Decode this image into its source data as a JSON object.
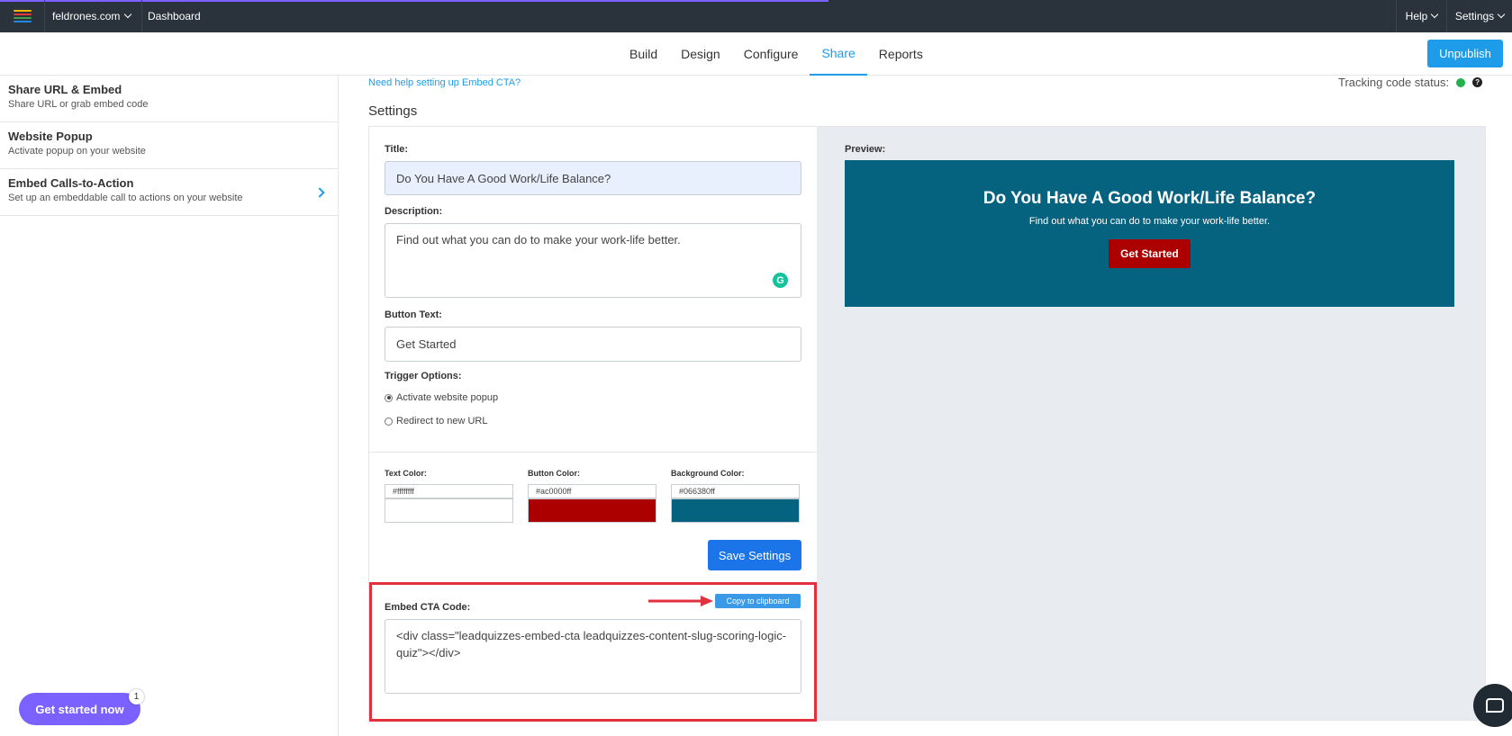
{
  "topbar": {
    "site": "feldrones.com",
    "dashboard": "Dashboard",
    "help": "Help",
    "settings": "Settings"
  },
  "tabs": [
    {
      "label": "Build"
    },
    {
      "label": "Design"
    },
    {
      "label": "Configure"
    },
    {
      "label": "Share",
      "active": true
    },
    {
      "label": "Reports"
    }
  ],
  "unpublish_label": "Unpublish",
  "sidebar": {
    "items": [
      {
        "title": "Share URL & Embed",
        "subtitle": "Share URL or grab embed code"
      },
      {
        "title": "Website Popup",
        "subtitle": "Activate popup on your website"
      },
      {
        "title": "Embed Calls-to-Action",
        "subtitle": "Set up an embeddable call to actions on your website"
      }
    ],
    "get_started": "Get started now",
    "badge_count": "1"
  },
  "main": {
    "help_link": "Need help setting up Embed CTA?",
    "tracking_label": "Tracking code status:",
    "settings_title": "Settings",
    "form": {
      "title_label": "Title:",
      "title_value": "Do You Have A Good Work/Life Balance?",
      "description_label": "Description:",
      "description_value": "Find out what you can do to make your work-life better.",
      "button_text_label": "Button Text:",
      "button_text_value": "Get Started",
      "trigger_label": "Trigger Options:",
      "trigger_options": [
        {
          "label": "Activate website popup",
          "selected": true
        },
        {
          "label": "Redirect to new URL",
          "selected": false
        }
      ],
      "text_color_label": "Text Color:",
      "text_color_value": "#ffffffff",
      "button_color_label": "Button Color:",
      "button_color_value": "#ac0000ff",
      "background_color_label": "Background Color:",
      "background_color_value": "#066380ff",
      "save_label": "Save Settings",
      "embed_label": "Embed CTA Code:",
      "copy_label": "Copy to clipboard",
      "embed_code": "<div class=\"leadquizzes-embed-cta leadquizzes-content-slug-scoring-logic-quiz\"></div>"
    },
    "preview": {
      "label": "Preview:",
      "title": "Do You Have A Good Work/Life Balance?",
      "description": "Find out what you can do to make your work-life better.",
      "button": "Get Started"
    }
  },
  "colors": {
    "accent": "#1e9be9",
    "purple": "#7b61ff",
    "preview_text": "#ffffff",
    "preview_button": "#ac0000",
    "preview_bg": "#066380",
    "highlight_red": "#e0313d"
  },
  "icons": {
    "menu": "hamburger-menu-icon",
    "status": "status-dot-icon",
    "help": "question-icon",
    "grammarly": "grammarly-icon",
    "chat": "chat-icon"
  }
}
